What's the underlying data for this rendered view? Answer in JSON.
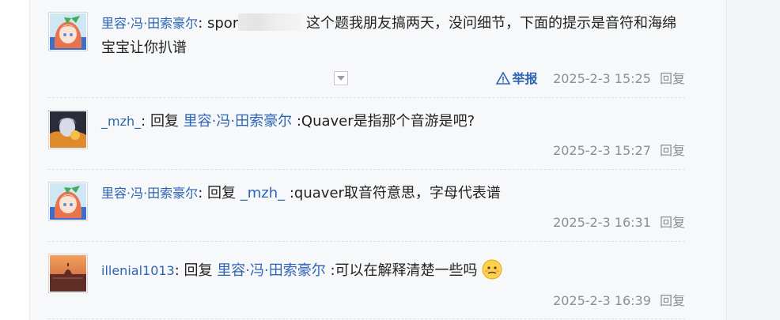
{
  "comments": [
    {
      "username": "里容·冯·田索豪尔",
      "sep": ":",
      "text_prefix": "spor",
      "text": "这个题我朋友搞两天，没问细节，下面的提示是音符和海绵宝宝让你扒谱",
      "report_label": "举报",
      "time": "2025-2-3 15:25",
      "reply_label": "回复"
    },
    {
      "username": "_mzh_",
      "sep": ":",
      "reply_word": "回复",
      "target": "里容·冯·田索豪尔",
      "text": ":Quaver是指那个音游是吧?",
      "time": "2025-2-3 15:27",
      "reply_label": "回复"
    },
    {
      "username": "里容·冯·田索豪尔",
      "sep": ":",
      "reply_word": "回复",
      "target": "_mzh_",
      "text": ":quaver取音符意思，字母代表谱",
      "time": "2025-2-3 16:31",
      "reply_label": "回复"
    },
    {
      "username": "illenial1013",
      "sep": ":",
      "reply_word": "回复",
      "target": "里容·冯·田索豪尔",
      "text": ":可以在解释清楚一些吗",
      "emoji": "grimace-emoji",
      "time": "2025-2-3 16:39",
      "reply_label": "回复"
    }
  ],
  "colors": {
    "link": "#2d64b3",
    "meta": "#8a8e96",
    "panel": "#f7f8fa"
  }
}
